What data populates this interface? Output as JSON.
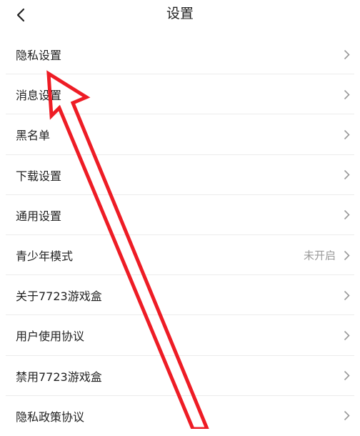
{
  "header": {
    "title": "设置",
    "back_icon": "chevron-left-icon"
  },
  "settings": {
    "items": [
      {
        "label": "隐私设置",
        "value": ""
      },
      {
        "label": "消息设置",
        "value": ""
      },
      {
        "label": "黑名单",
        "value": ""
      },
      {
        "label": "下载设置",
        "value": ""
      },
      {
        "label": "通用设置",
        "value": ""
      },
      {
        "label": "青少年模式",
        "value": "未开启"
      },
      {
        "label": "关于7723游戏盒",
        "value": ""
      },
      {
        "label": "用户使用协议",
        "value": ""
      },
      {
        "label": "禁用7723游戏盒",
        "value": ""
      },
      {
        "label": "隐私政策协议",
        "value": ""
      }
    ]
  },
  "colors": {
    "annotation_arrow": "#ee1c25",
    "divider": "#ececec",
    "secondary_text": "#9a9a9a"
  }
}
